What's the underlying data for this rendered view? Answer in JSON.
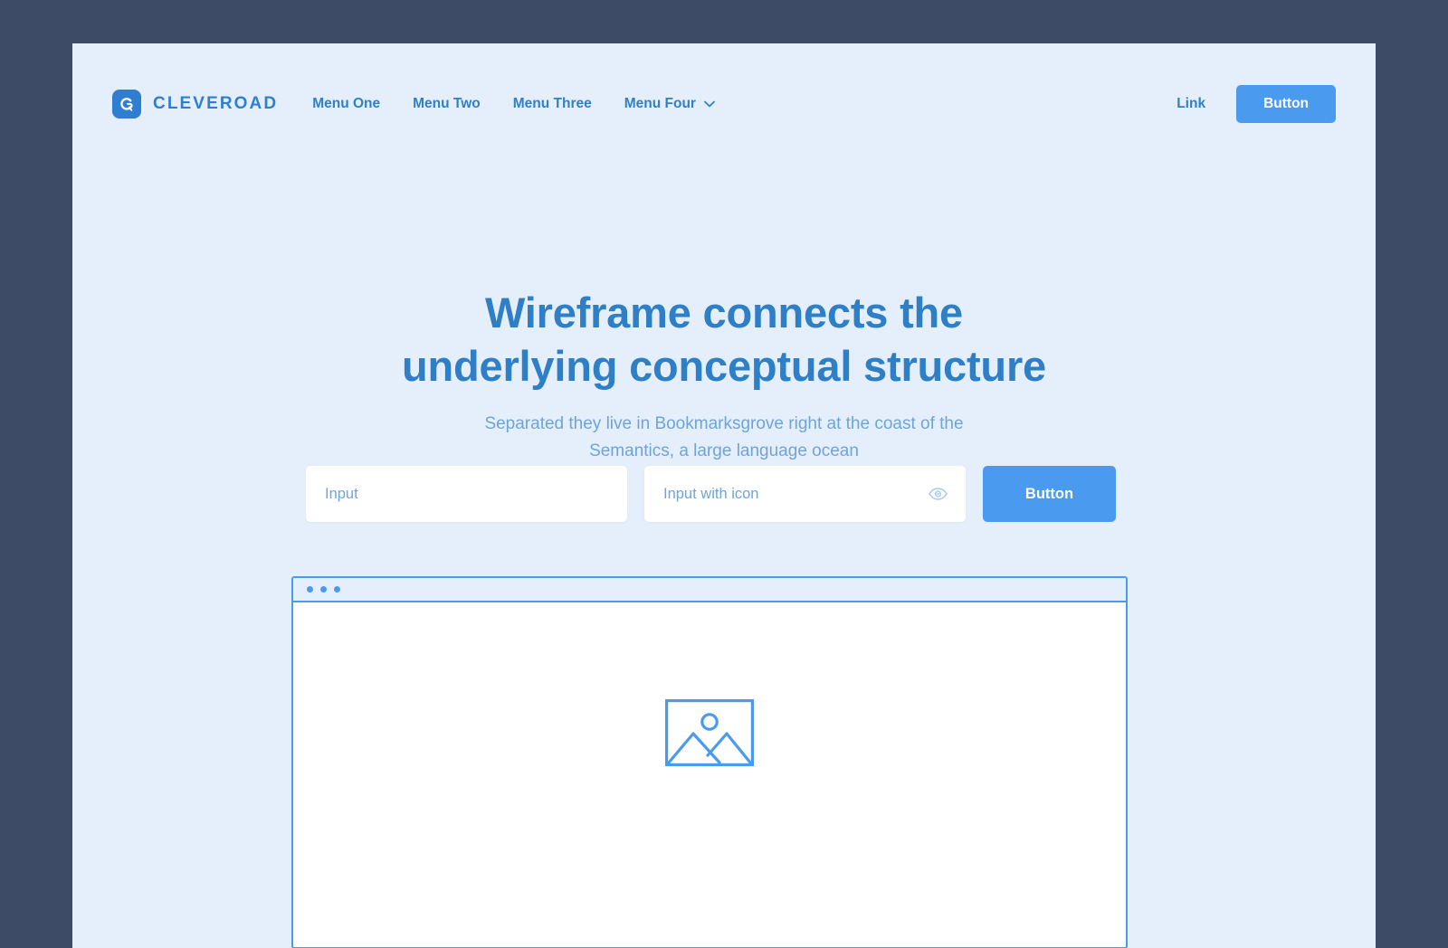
{
  "brand": {
    "name": "CLEVEROAD",
    "mark_icon": "cleveroad-logo-icon",
    "mark_color": "#2f7ed1"
  },
  "nav": {
    "items": [
      {
        "label": "Menu One",
        "icon": null
      },
      {
        "label": "Menu Two",
        "icon": null
      },
      {
        "label": "Menu Three",
        "icon": null
      },
      {
        "label": "Menu Four",
        "icon": "chevron-down-icon"
      }
    ],
    "link_label": "Link",
    "button_label": "Button",
    "link_color": "#3180c6",
    "button_color": "#4a9bf0"
  },
  "hero": {
    "title_line_1": "Wireframe connects the",
    "title_line_2": "underlying conceptual structure",
    "subtitle_line_1": "Separated they live in Bookmarksgrove right at the coast of the",
    "subtitle_line_2": "Semantics, a large language ocean",
    "title_color": "#2e7fc6",
    "subtitle_color": "#6fa4d8"
  },
  "form": {
    "input_placeholder": "Input",
    "input_with_icon_placeholder": "Input with icon",
    "input_icon": "eye-icon",
    "button_label": "Button",
    "button_color": "#4a9bf0"
  },
  "mockup": {
    "dots": [
      "dot-1",
      "dot-2",
      "dot-3"
    ],
    "content_icon": "image-placeholder-icon",
    "border_color": "#4a9bf0",
    "body_color": "#ffffff"
  },
  "page": {
    "background_color": "#3e4b66",
    "card_background_color": "#e4effb"
  }
}
